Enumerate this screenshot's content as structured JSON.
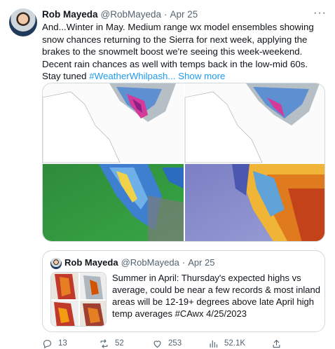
{
  "tweet": {
    "name": "Rob Mayeda",
    "handle": "@RobMayeda",
    "separator": "·",
    "time": "Apr 25",
    "text": "And...Winter in May. Medium range wx model ensembles showing snow chances returning to the Sierra for next week, applying the brakes to the snowmelt boost we're seeing this week-weekend.  Decent rain chances as well with temps back in the low-mid 60s. Stay tuned ",
    "hashtag": "#WeatherWhilpash...",
    "show_more": "Show more",
    "more_icon": "more-icon"
  },
  "quote": {
    "name": "Rob Mayeda",
    "handle": "@RobMayeda",
    "separator": "·",
    "time": "Apr 25",
    "text": "Summer in April: Thursday's expected highs vs average, could be near a few records & most inland areas will be 12-19+ degrees above late April high temp averages #CAwx 4/25/2023"
  },
  "actions": {
    "replies": "13",
    "retweets": "52",
    "likes": "253",
    "views": "52.1K"
  },
  "colors": {
    "accent": "#1d9bf0",
    "secondary_text": "#536471",
    "border": "#cfd9de"
  }
}
